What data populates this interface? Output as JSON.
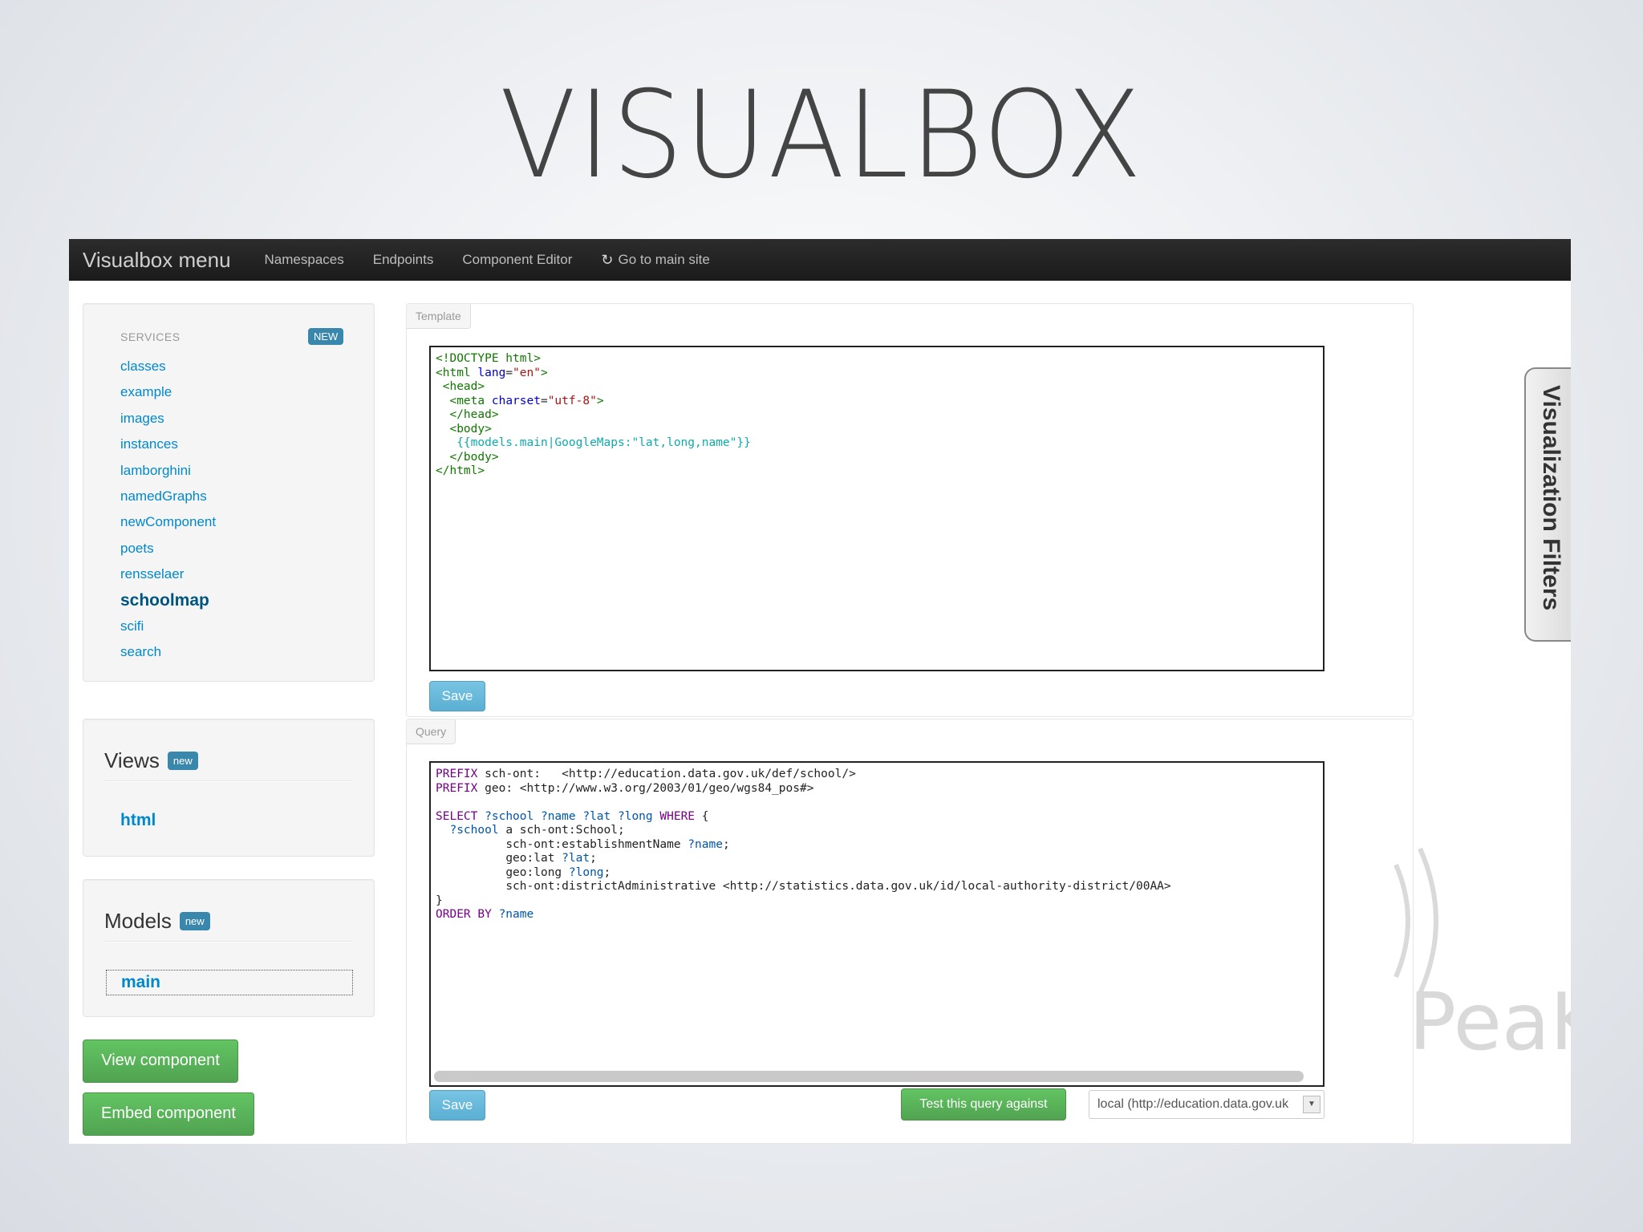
{
  "slide": {
    "title": "VISUALBOX"
  },
  "navbar": {
    "brand": "Visualbox menu",
    "items": [
      {
        "label": "Namespaces"
      },
      {
        "label": "Endpoints"
      },
      {
        "label": "Component Editor"
      },
      {
        "label": "Go to main site",
        "icon": "refresh-icon"
      }
    ]
  },
  "services": {
    "header": "SERVICES",
    "badge": "NEW",
    "items": [
      "classes",
      "example",
      "images",
      "instances",
      "lamborghini",
      "namedGraphs",
      "newComponent",
      "poets",
      "rensselaer",
      "schoolmap",
      "scifi",
      "search"
    ],
    "active": "schoolmap"
  },
  "views": {
    "title": "Views",
    "badge": "new",
    "items": [
      "html"
    ]
  },
  "models": {
    "title": "Models",
    "badge": "new",
    "items": [
      "main"
    ]
  },
  "buttons": {
    "view_component": "View component",
    "embed_component": "Embed component"
  },
  "template_panel": {
    "tab": "Template",
    "save": "Save"
  },
  "query_panel": {
    "tab": "Query",
    "save": "Save",
    "test_button": "Test this query against",
    "endpoint_selected": "local (http://education.data.gov.uk"
  },
  "side_tab": {
    "label": "Visualization Filters"
  },
  "watermark": {
    "text": "PeaKr"
  },
  "colors": {
    "navbar": "#1b1b1b",
    "link": "#0088cc",
    "badge": "#3a87ad",
    "green": "#51a351",
    "save": "#5aafd2"
  }
}
